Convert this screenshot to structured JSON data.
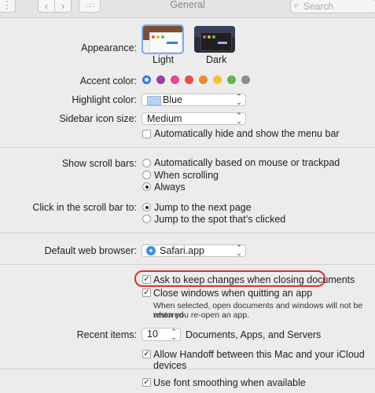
{
  "window": {
    "title": "General",
    "search_placeholder": "Search"
  },
  "appearance": {
    "label": "Appearance:",
    "options": [
      "Light",
      "Dark"
    ],
    "selected": "Light"
  },
  "accent": {
    "label": "Accent color:",
    "colors": [
      "#2a7ff6",
      "#9b3ea7",
      "#e8468e",
      "#ec4c48",
      "#ef8a2c",
      "#f4c230",
      "#5fb748",
      "#8e8e8e"
    ]
  },
  "highlight": {
    "label": "Highlight color:",
    "value": "Blue",
    "swatch": "#b8d3f2"
  },
  "sidebar": {
    "label": "Sidebar icon size:",
    "value": "Medium"
  },
  "auto_hide": {
    "label": "Automatically hide and show the menu bar",
    "checked": false
  },
  "scroll_bars": {
    "label": "Show scroll bars:",
    "options": [
      "Automatically based on mouse or trackpad",
      "When scrolling",
      "Always"
    ],
    "selected": "Always"
  },
  "scroll_click": {
    "label": "Click in the scroll bar to:",
    "options": [
      "Jump to the next page",
      "Jump to the spot that’s clicked"
    ],
    "selected": "Jump to the next page"
  },
  "browser": {
    "label": "Default web browser:",
    "value": "Safari.app"
  },
  "ask_keep": {
    "label": "Ask to keep changes when closing documents",
    "checked": true
  },
  "close_windows": {
    "label": "Close windows when quitting an app",
    "checked": true,
    "note_line1": "When selected, open documents and windows will not be restored",
    "note_line2": "when you re-open an app."
  },
  "recent": {
    "label": "Recent items:",
    "value": "10",
    "suffix": "Documents, Apps, and Servers"
  },
  "handoff": {
    "label": "Allow Handoff between this Mac and your iCloud devices",
    "checked": true
  },
  "font_smoothing": {
    "label": "Use font smoothing when available",
    "checked": true
  }
}
